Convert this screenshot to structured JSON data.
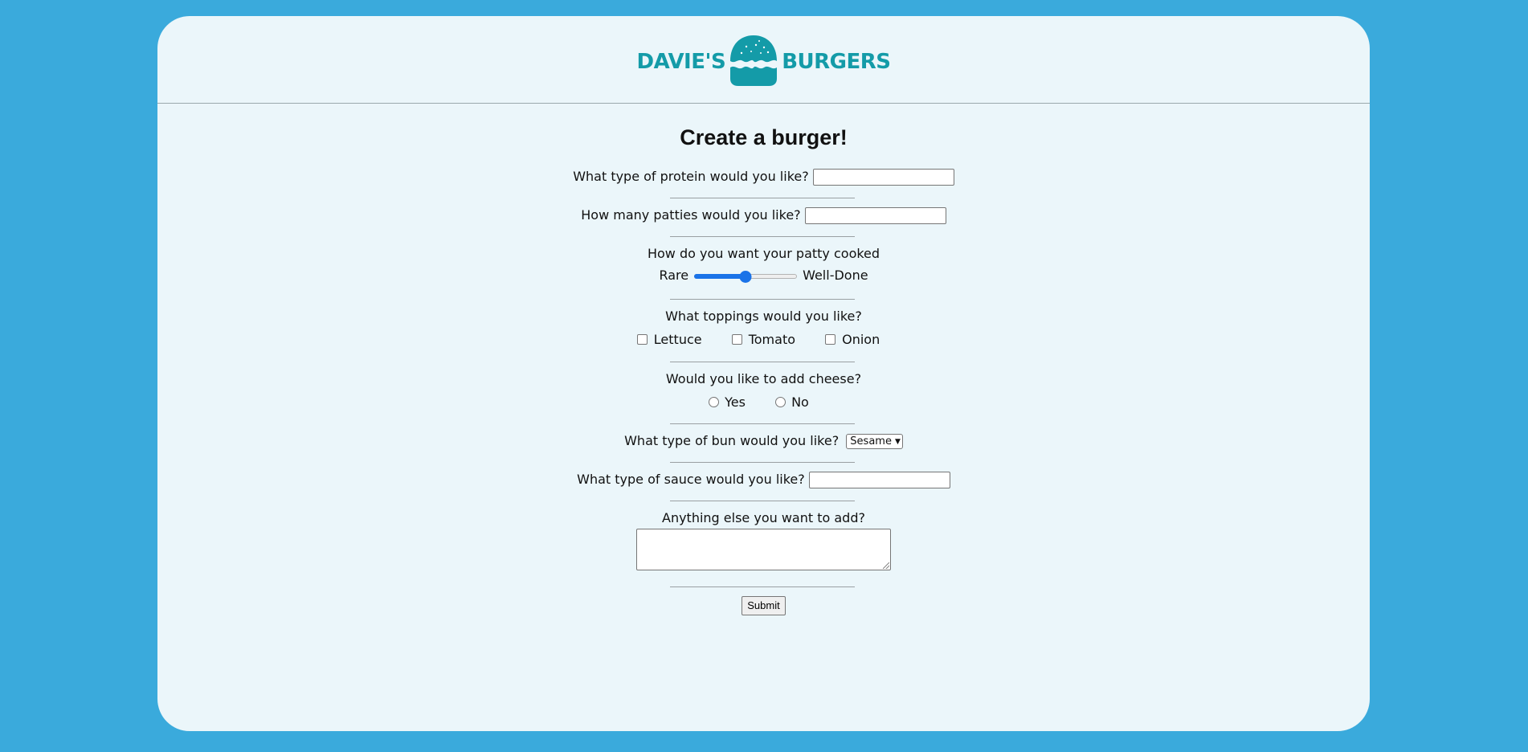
{
  "brand": {
    "left_word": "DAVIE'S",
    "right_word": "BURGERS",
    "logo_icon": "burger-icon",
    "color": "#149ba8"
  },
  "form": {
    "title": "Create a burger!",
    "protein": {
      "label": "What type of protein would you like?",
      "value": ""
    },
    "patties": {
      "label": "How many patties would you like?",
      "value": ""
    },
    "doneness": {
      "label": "How do you want your patty cooked",
      "min_label": "Rare",
      "max_label": "Well-Done",
      "value_fraction": 0.5
    },
    "toppings": {
      "label": "What toppings would you like?",
      "options": [
        "Lettuce",
        "Tomato",
        "Onion"
      ]
    },
    "cheese": {
      "label": "Would you like to add cheese?",
      "options": [
        "Yes",
        "No"
      ]
    },
    "bun": {
      "label": "What type of bun would you like?",
      "selected": "Sesame"
    },
    "sauce": {
      "label": "What type of sauce would you like?",
      "value": ""
    },
    "extra": {
      "label": "Anything else you want to add?",
      "value": ""
    },
    "submit_label": "Submit"
  },
  "colors": {
    "background": "#3aaadc",
    "card": "#ebf6fa",
    "accent": "#1a73e8"
  }
}
